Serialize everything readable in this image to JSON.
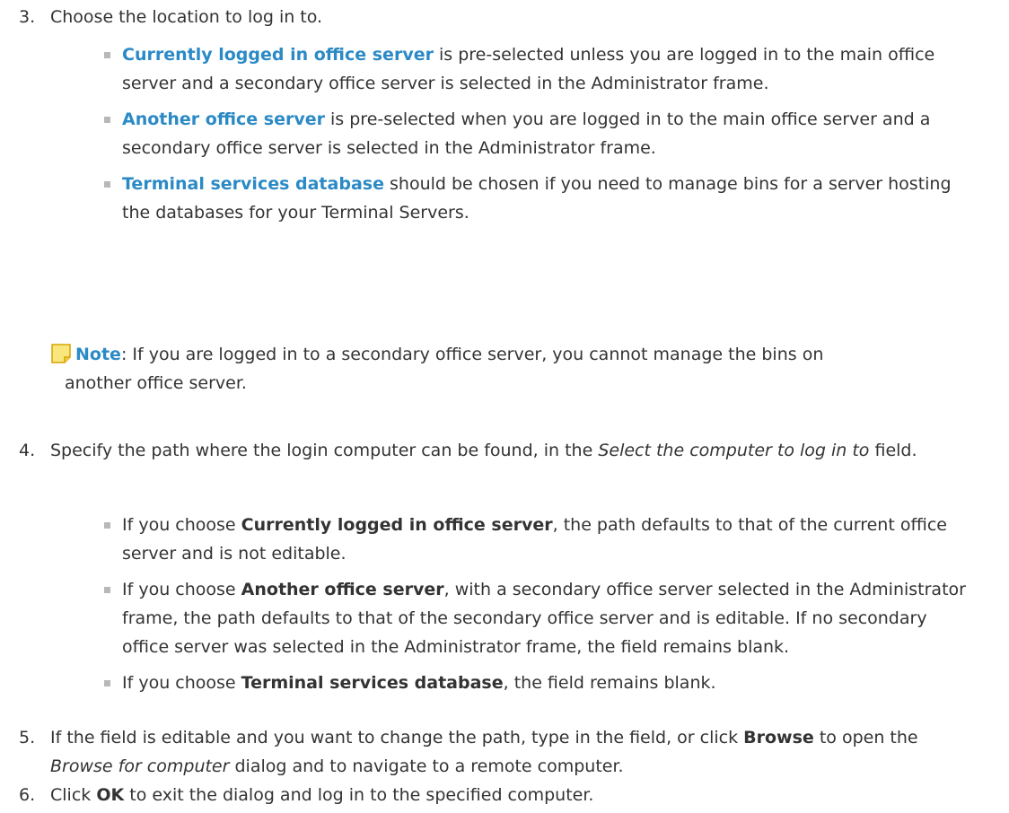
{
  "steps": [
    {
      "number": "3.",
      "text": "Choose the location to log in to.",
      "bullets": [
        {
          "term": "Currently logged in office server",
          "rest": " is pre-selected unless you are logged in to the main office server and a secondary office server is selected in the Administrator frame."
        },
        {
          "term": "Another office server",
          "rest": " is pre-selected when you are logged in to the main office server and a secondary office server is selected in the Administrator frame."
        },
        {
          "term": "Terminal services database",
          "rest": " should be chosen if you need to manage bins for a server hosting the databases for your Terminal Servers."
        }
      ]
    },
    {
      "number": "4.",
      "text_before": "Specify the path where the login computer can be found, in the ",
      "text_italic": "Select the computer to log in to",
      "text_after": " field.",
      "bullets": [
        {
          "prefix": "If you choose ",
          "term": "Currently logged in office server",
          "rest": ", the path defaults to that of the current office server and is not editable."
        },
        {
          "prefix": "If you choose ",
          "term": "Another office server",
          "rest": ", with a secondary office server selected in the Administrator frame, the path defaults to that of the secondary office server and is editable. If no secondary office server was selected in the Administrator frame, the field remains blank."
        },
        {
          "prefix": "If you choose ",
          "term": "Terminal services database",
          "rest": ", the field remains blank."
        }
      ]
    },
    {
      "number": "5.",
      "text_before": "If the field is editable and you want to change the path, type in the field, or click ",
      "text_bold": "Browse",
      "text_middle": " to open the ",
      "text_italic": "Browse for computer",
      "text_after": " dialog and to navigate to a remote computer."
    },
    {
      "number": "6.",
      "text_before": "Click ",
      "text_bold": "OK",
      "text_after": " to exit the dialog and log in to the specified computer."
    }
  ],
  "note": {
    "label": "Note",
    "line1": ": If you are logged in to a secondary office server, you cannot manage the bins on",
    "line2": "another office server.",
    "icon": "note-icon",
    "icon_color": "#f7e77c",
    "icon_border": "#d9a400"
  },
  "colors": {
    "text": "#333333",
    "accent": "#2b8ac6",
    "bullet": "#b8b8b8"
  }
}
